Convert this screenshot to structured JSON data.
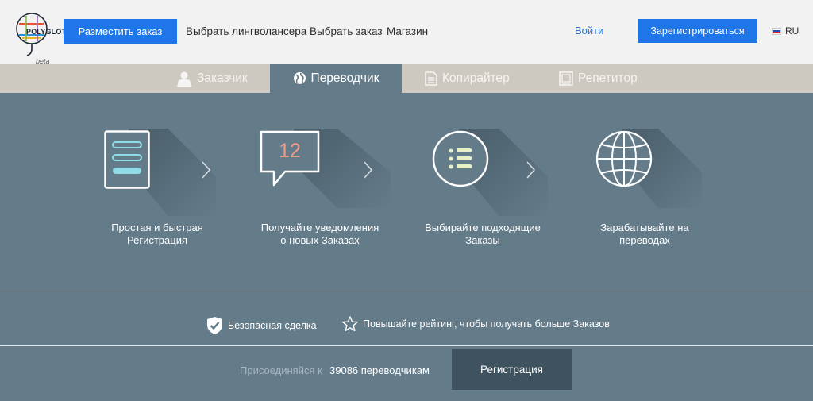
{
  "header": {
    "logo_text": "POLYGLOT",
    "logo_badge": "beta",
    "place_order": "Разместить заказ",
    "nav": [
      "Выбрать лингволансера",
      "Выбрать заказ",
      "Магазин"
    ],
    "login": "Войти",
    "register": "Зарегистрироваться",
    "lang": "RU",
    "accent_color": "#1e76e8"
  },
  "tabs": [
    {
      "label": "Заказчик",
      "icon": "user-icon",
      "active": false
    },
    {
      "label": "Переводчик",
      "icon": "globe-icon",
      "active": true
    },
    {
      "label": "Копирайтер",
      "icon": "document-icon",
      "active": false
    },
    {
      "label": "Репетитор",
      "icon": "book-icon",
      "active": false
    }
  ],
  "steps": [
    {
      "line1": "Простая и быстрая",
      "line2": "Регистрация",
      "icon": "form-icon"
    },
    {
      "line1": "Получайте уведомления",
      "line2": "о новых Заказах",
      "icon": "notification-bubble-icon",
      "badge": "12"
    },
    {
      "line1": "Выбирайте подходящие",
      "line2": "Заказы",
      "icon": "list-icon"
    },
    {
      "line1": "Зарабатывайте на",
      "line2": "переводах",
      "icon": "globe-icon"
    }
  ],
  "features": {
    "safe_deal": "Безопасная сделка",
    "rating": "Повышайте рейтинг, чтобы получать больше Заказов"
  },
  "join": {
    "prefix": "Присоединяйся к",
    "count": "39086 переводчикам",
    "button": "Регистрация"
  }
}
